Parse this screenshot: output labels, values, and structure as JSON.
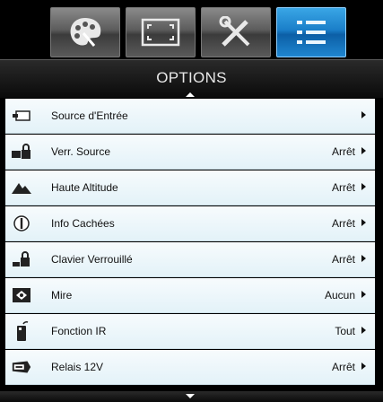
{
  "header": {
    "title": "OPTIONS"
  },
  "tabs": [
    {
      "icon": "palette-icon",
      "active": false
    },
    {
      "icon": "display-frame-icon",
      "active": false
    },
    {
      "icon": "tools-icon",
      "active": false
    },
    {
      "icon": "menu-list-icon",
      "active": true
    }
  ],
  "items": [
    {
      "label": "Source d'Entrée",
      "value": "",
      "icon": "input-source-icon"
    },
    {
      "label": "Verr. Source",
      "value": "Arrêt",
      "icon": "source-lock-icon"
    },
    {
      "label": "Haute Altitude",
      "value": "Arrêt",
      "icon": "mountain-icon"
    },
    {
      "label": "Info Cachées",
      "value": "Arrêt",
      "icon": "info-icon"
    },
    {
      "label": "Clavier Verrouillé",
      "value": "Arrêt",
      "icon": "keypad-lock-icon"
    },
    {
      "label": "Mire",
      "value": "Aucun",
      "icon": "test-pattern-icon"
    },
    {
      "label": "Fonction IR",
      "value": "Tout",
      "icon": "remote-icon"
    },
    {
      "label": "Relais 12V",
      "value": "Arrêt",
      "icon": "relay-12v-icon"
    }
  ],
  "colors": {
    "accent": "#1a7fc9",
    "row_bg": "#e8f4f9",
    "frame": "#000000"
  }
}
